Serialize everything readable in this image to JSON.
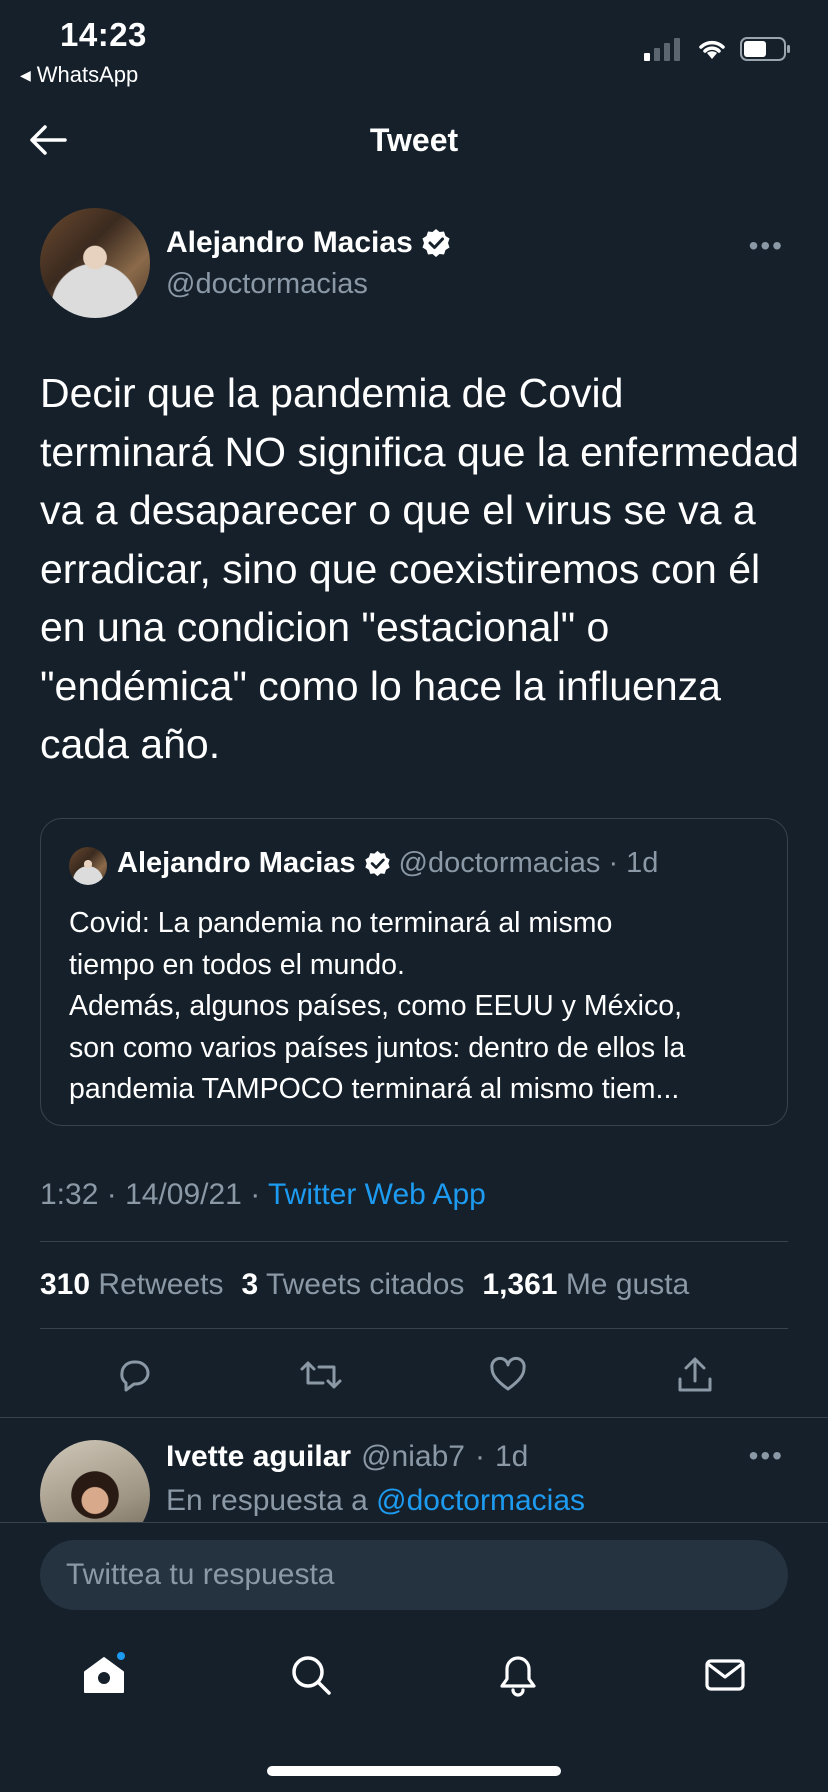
{
  "status_bar": {
    "time": "14:23",
    "back_app": "WhatsApp"
  },
  "header": {
    "title": "Tweet"
  },
  "tweet": {
    "author_name": "Alejandro Macias",
    "author_handle": "@doctormacias",
    "text": "Decir que la pandemia de Covid terminará NO significa que la enfermedad va a desaparecer o que el virus se va a erradicar, sino que coexistiremos con él en una condicion \"estacional\" o \"endémica\" como lo hace la influenza cada año.",
    "time": "1:32",
    "date": "14/09/21",
    "source_app": "Twitter Web App",
    "stats": {
      "retweets_count": "310",
      "retweets_label": "Retweets",
      "quotes_count": "3",
      "quotes_label": "Tweets citados",
      "likes_count": "1,361",
      "likes_label": "Me gusta"
    }
  },
  "quoted_tweet": {
    "author_name": "Alejandro Macias",
    "author_handle": "@doctormacias",
    "age": "1d",
    "lines": [
      "Covid: La pandemia no terminará al mismo",
      "tiempo en todos el mundo.",
      "Además, algunos países, como EEUU y México,",
      "son como varios países juntos: dentro de ellos la",
      "pandemia TAMPOCO terminará al mismo tiem..."
    ]
  },
  "reply": {
    "author_name": "Ivette aguilar",
    "author_handle": "@niab7",
    "age": "1d",
    "replying_to_label": "En respuesta a",
    "replying_to_handle": "@doctormacias"
  },
  "compose": {
    "placeholder": "Twittea tu respuesta"
  },
  "colors": {
    "background": "#15202b",
    "accent": "#1d9bf0",
    "secondary_text": "#8b98a5",
    "border": "#38444d"
  },
  "icons": {
    "actions": [
      "reply-icon",
      "retweet-icon",
      "like-icon",
      "share-icon"
    ],
    "tabs": [
      "home-icon",
      "search-icon",
      "notifications-icon",
      "messages-icon"
    ]
  }
}
